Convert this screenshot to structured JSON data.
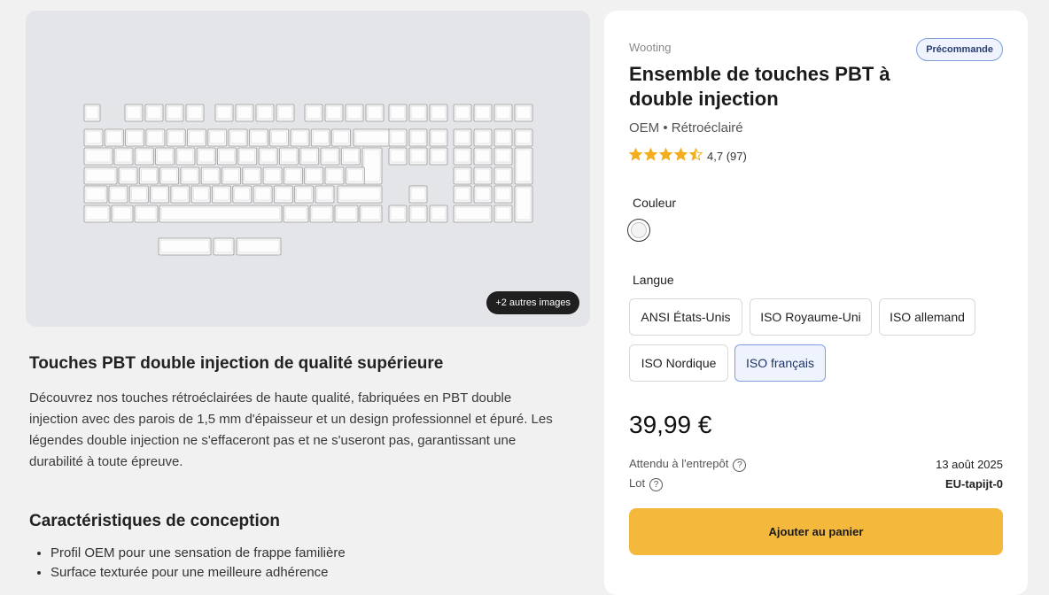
{
  "gallery": {
    "more_images_label": "+2 autres images"
  },
  "description": {
    "heading": "Touches PBT double injection de qualité supérieure",
    "body": "Découvrez nos touches rétroéclairées de haute qualité, fabriquées en PBT double injection avec des parois de 1,5 mm d'épaisseur et un design professionnel et épuré. Les légendes double injection ne s'effaceront pas et ne s'useront pas, garantissant une durabilité à toute épreuve.",
    "features_heading": "Caractéristiques de conception",
    "features": [
      "Profil OEM pour une sensation de frappe familière",
      "Surface texturée pour une meilleure adhérence"
    ]
  },
  "product": {
    "brand": "Wooting",
    "badge": "Précommande",
    "title": "Ensemble de touches PBT à double injection",
    "subtitle": "OEM • Rétroéclairé",
    "rating_value": "4,7",
    "rating_count": "(97)",
    "stars_filled": 4.5,
    "color_label": "Couleur",
    "color_selected": "#f4f4f4",
    "language_label": "Langue",
    "languages": [
      {
        "label": "ANSI États-Unis",
        "selected": false
      },
      {
        "label": "ISO Royaume-Uni",
        "selected": false
      },
      {
        "label": "ISO allemand",
        "selected": false
      },
      {
        "label": "ISO Nordique",
        "selected": false
      },
      {
        "label": "ISO français",
        "selected": true
      }
    ],
    "price": "39,99 €",
    "expected_label": "Attendu à l'entrepôt",
    "expected_value": "13 août 2025",
    "lot_label": "Lot",
    "lot_value": "EU-tapijt-0",
    "add_to_cart": "Ajouter au panier"
  },
  "colors": {
    "accent": "#f4b93c",
    "selected_border": "#7e9fd9",
    "selected_bg": "#eef3fd",
    "star": "#f2ae1c"
  }
}
